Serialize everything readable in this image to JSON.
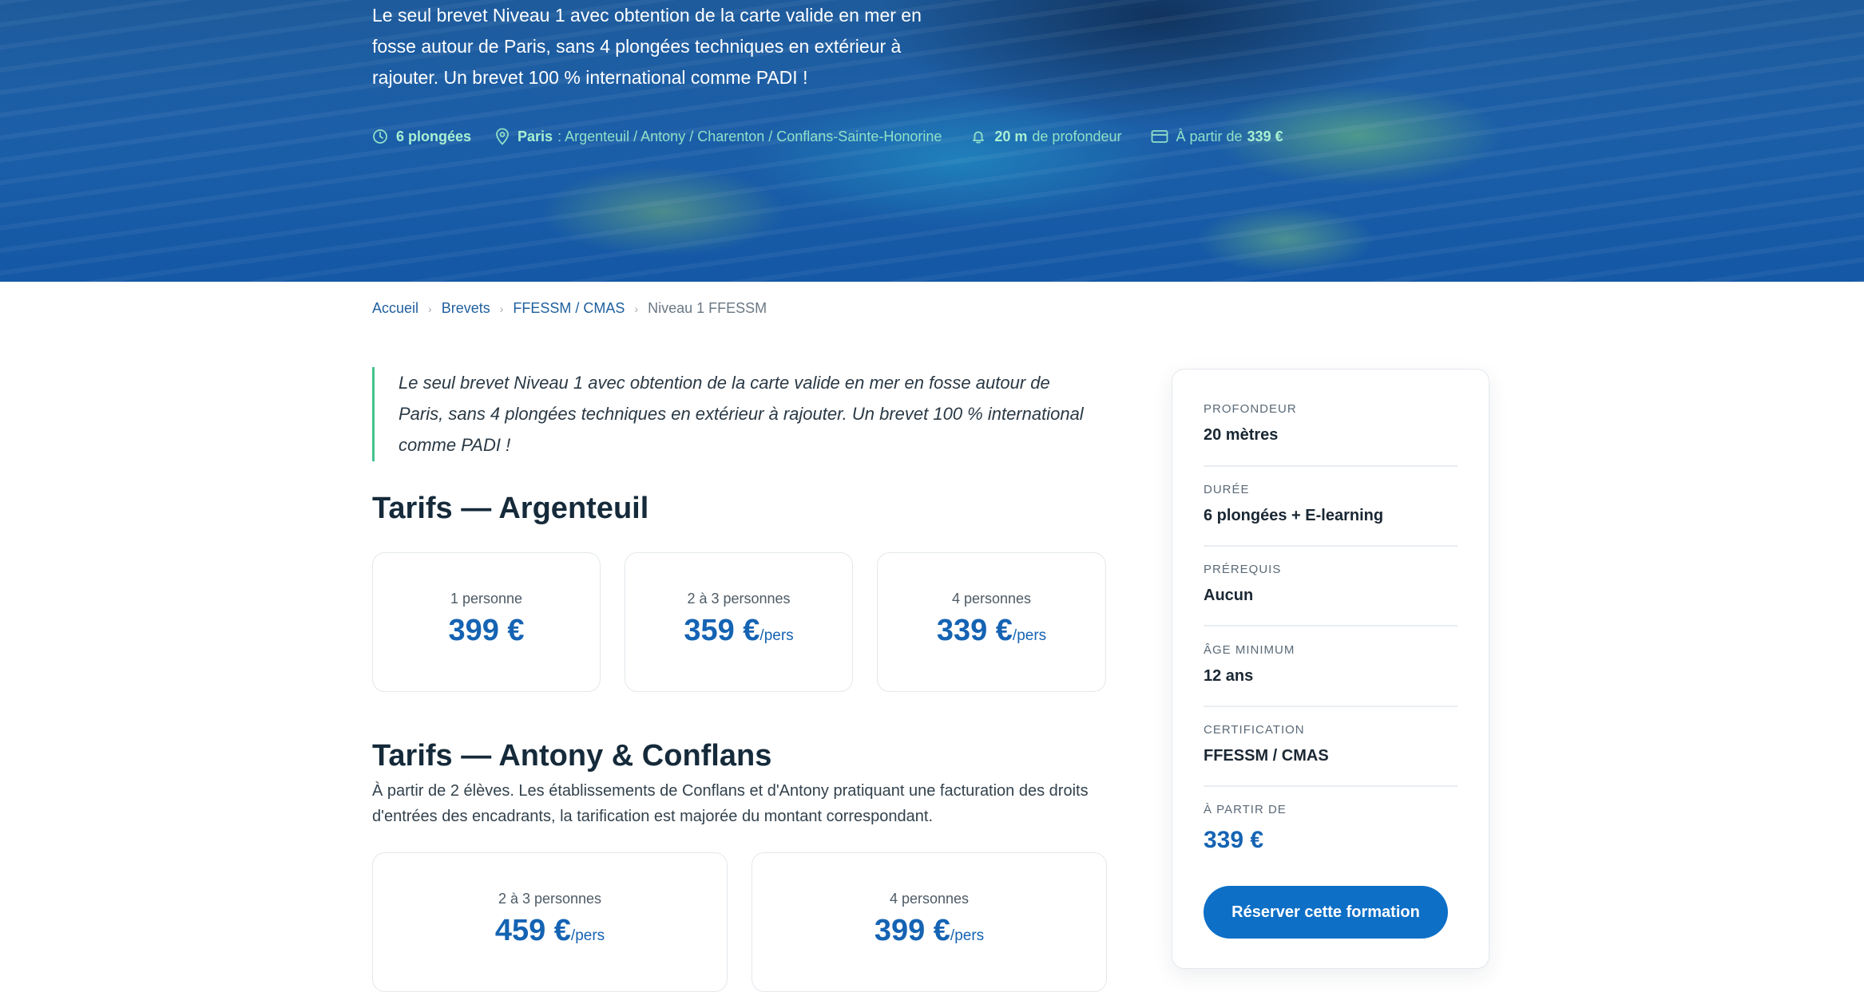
{
  "hero": {
    "description": "Le seul brevet Niveau 1 avec obtention de la carte valide en mer en fosse autour de Paris, sans 4 plongées techniques en extérieur à rajouter. Un brevet 100 % international comme PADI !",
    "meta": {
      "dives": "6 plongées",
      "city": "Paris",
      "places": ": Argenteuil / Antony / Charenton / Conflans-Sainte-Honorine",
      "depth_value": "20 m",
      "depth_label": "de profondeur",
      "price_prefix": "À partir de",
      "price_value": "339 €",
      "icons": [
        "clock-icon",
        "map-pin-icon",
        "bell-icon",
        "credit-card-icon"
      ]
    }
  },
  "breadcrumb": {
    "items": [
      "Accueil",
      "Brevets",
      "FFESSM / CMAS"
    ],
    "current": "Niveau 1 FFESSM",
    "separator": "›"
  },
  "intro_quote": "Le seul brevet Niveau 1 avec obtention de la carte valide en mer en fosse autour de Paris, sans 4 plongées techniques en extérieur à rajouter. Un brevet 100 % international comme PADI !",
  "pricing_argenteuil": {
    "title": "Tarifs — Argenteuil",
    "cards": [
      {
        "label": "1 personne",
        "amount": "399 €",
        "suffix": ""
      },
      {
        "label": "2 à 3 personnes",
        "amount": "359 €",
        "suffix": "/pers"
      },
      {
        "label": "4 personnes",
        "amount": "339 €",
        "suffix": "/pers"
      }
    ]
  },
  "pricing_antony": {
    "title": "Tarifs — Antony & Conflans",
    "note": "À partir de 2 élèves. Les établissements de Conflans et d'Antony pratiquant une facturation des droits d'entrées des encadrants, la tarification est majorée du montant correspondant.",
    "cards": [
      {
        "label": "2 à 3 personnes",
        "amount": "459 €",
        "suffix": "/pers"
      },
      {
        "label": "4 personnes",
        "amount": "399 €",
        "suffix": "/pers"
      }
    ]
  },
  "sidebar": {
    "rows": [
      {
        "key": "PROFONDEUR",
        "value": "20 mètres"
      },
      {
        "key": "DURÉE",
        "value": "6 plongées + E-learning"
      },
      {
        "key": "PRÉREQUIS",
        "value": "Aucun"
      },
      {
        "key": "ÂGE MINIMUM",
        "value": "12 ans"
      },
      {
        "key": "CERTIFICATION",
        "value": "FFESSM / CMAS"
      },
      {
        "key": "À PARTIR DE",
        "value": "339 €"
      }
    ],
    "cta_label": "Réserver cette formation"
  },
  "colors": {
    "accent": "#1563b3",
    "cta": "#0d6fc6",
    "quote_border": "#44c28e",
    "hero_meta": "#8fe0c7"
  }
}
